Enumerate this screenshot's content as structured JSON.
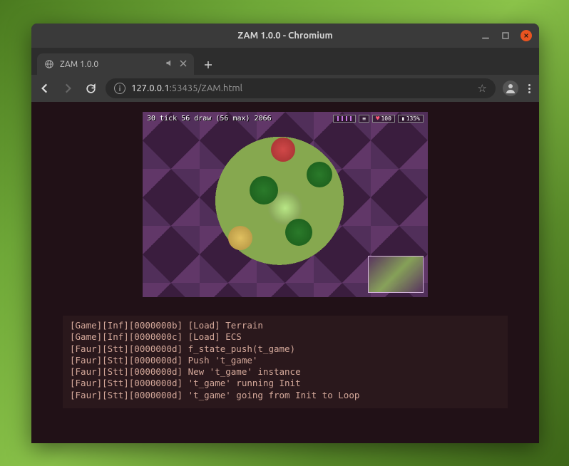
{
  "window": {
    "title": "ZAM 1.0.0 - Chromium"
  },
  "tab": {
    "title": "ZAM 1.0.0"
  },
  "toolbar": {
    "url_host": "127.0.0.1",
    "url_port": ":53435",
    "url_path": "/ZAM.html"
  },
  "hud": {
    "line1": "30 tick",
    "line2": "56 draw (56 max)",
    "line3": "2066",
    "hp": "100",
    "energy": "135%"
  },
  "console": {
    "lines": [
      "[Game][Inf][0000000b] [Load] Terrain",
      "[Game][Inf][0000000c] [Load] ECS",
      "[Faur][Stt][0000000d] f_state_push(t_game)",
      "[Faur][Stt][0000000d] Push 't_game'",
      "[Faur][Stt][0000000d] New 't_game' instance",
      "[Faur][Stt][0000000d] 't_game' running Init",
      "[Faur][Stt][0000000d] 't_game' going from Init to Loop"
    ]
  }
}
